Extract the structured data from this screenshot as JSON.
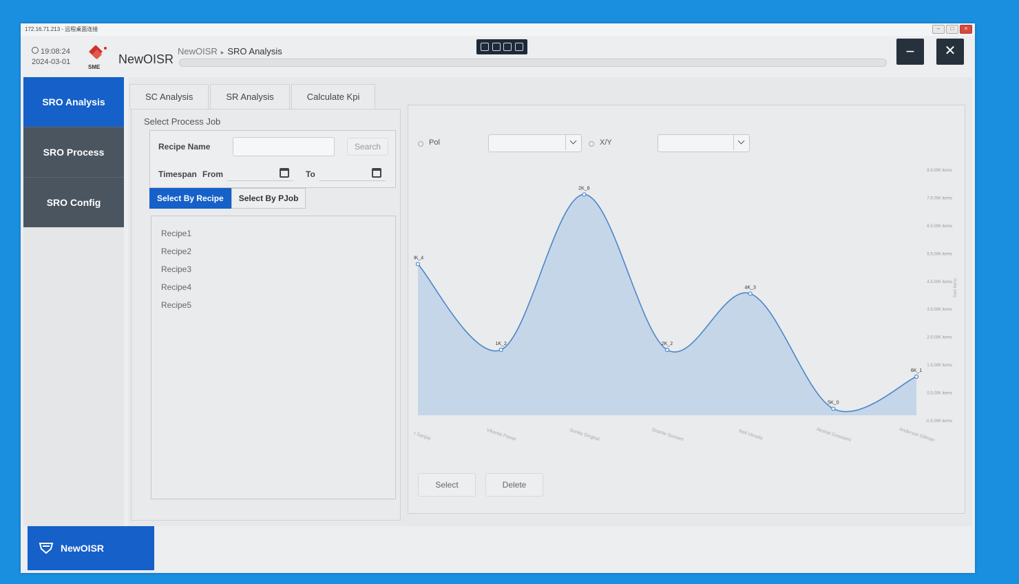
{
  "window": {
    "title": "172.16.71.213 - 远程桌面连接"
  },
  "header": {
    "time": "19:08:24",
    "date": "2024-03-01",
    "logo_text": "SME",
    "app_name": "NewOISR",
    "breadcrumb": [
      "NewOISR",
      "SRO Analysis"
    ],
    "minimize_label": "−",
    "close_label": "✕"
  },
  "sidebar": {
    "items": [
      {
        "label": "SRO Analysis",
        "active": true
      },
      {
        "label": "SRO Process",
        "active": false
      },
      {
        "label": "SRO Config",
        "active": false
      }
    ],
    "footer_label": "NewOISR"
  },
  "tabs": [
    "SC Analysis",
    "SR Analysis",
    "Calculate Kpi"
  ],
  "left_panel": {
    "section_title": "Select Process Job",
    "recipe_label": "Recipe Name",
    "recipe_value": "",
    "search_label": "Search",
    "timespan_label": "Timespan",
    "from_label": "From",
    "to_label": "To",
    "select_by_recipe": "Select By Recipe",
    "select_by_pjob": "Select By PJob",
    "recipes": [
      "Recipe1",
      "Recipe2",
      "Recipe3",
      "Recipe4",
      "Recipe5"
    ]
  },
  "right_panel": {
    "pol_label": "Pol",
    "xy_label": "X/Y",
    "pol_value": "",
    "xy_value": "",
    "select_label": "Select",
    "delete_label": "Delete"
  },
  "chart_data": {
    "type": "area",
    "categories": [
      "Sher Sanjay",
      "Vikanta Pawar",
      "Sunita Singhal",
      "Shante Sonnen",
      "Neil Verada",
      "Akshat Goswami",
      "Anderson Dilman"
    ],
    "series": [
      {
        "values": [
          5.4,
          2.2,
          8.0,
          2.2,
          4.3,
          0.0,
          1.2
        ]
      }
    ],
    "point_labels": [
      "0K_4",
      "1K_2",
      "2K_8",
      "2K_2",
      "4K_3",
      "5K_0",
      "6K_1"
    ],
    "yticks": [
      "8.5.00K items",
      "7.5.00K items",
      "6.5.00K items",
      "5.5.00K items",
      "4.5.00K items",
      "3.5.00K items",
      "2.5.00K items",
      "1.5.00K items",
      "0.5.00K items",
      "-0.5.00K items"
    ],
    "ylim": [
      -0.5,
      8.5
    ],
    "ylabel": "Sold Items",
    "colors": {
      "line": "#4a86c8",
      "fill": "#b9cfe8"
    }
  }
}
